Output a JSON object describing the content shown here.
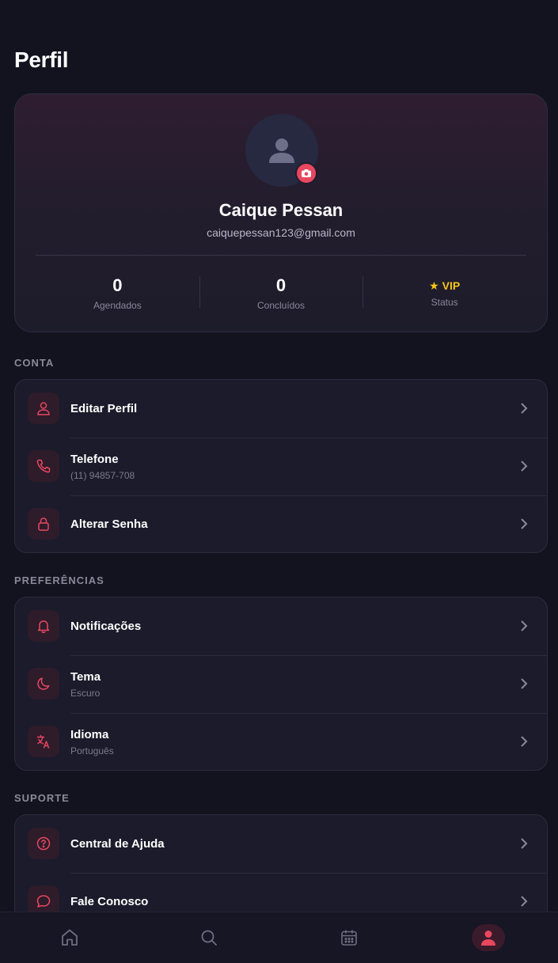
{
  "header": {
    "title": "Perfil"
  },
  "profile": {
    "name": "Caique Pessan",
    "email": "caiquepessan123@gmail.com",
    "stats": [
      {
        "value": "0",
        "label": "Agendados"
      },
      {
        "value": "0",
        "label": "Concluídos"
      },
      {
        "value": "★ VIP",
        "label": "Status"
      }
    ]
  },
  "sections": {
    "conta": {
      "title": "CONTA",
      "items": [
        {
          "label": "Editar Perfil",
          "sub": "",
          "icon": "user-icon"
        },
        {
          "label": "Telefone",
          "sub": "(11) 94857-708",
          "icon": "phone-icon"
        },
        {
          "label": "Alterar Senha",
          "sub": "",
          "icon": "lock-icon"
        }
      ]
    },
    "preferencias": {
      "title": "PREFERÊNCIAS",
      "items": [
        {
          "label": "Notificações",
          "sub": "",
          "icon": "bell-icon"
        },
        {
          "label": "Tema",
          "sub": "Escuro",
          "icon": "moon-icon"
        },
        {
          "label": "Idioma",
          "sub": "Português",
          "icon": "translate-icon"
        }
      ]
    },
    "suporte": {
      "title": "SUPORTE",
      "items": [
        {
          "label": "Central de Ajuda",
          "sub": "",
          "icon": "help-circle-icon"
        },
        {
          "label": "Fale Conosco",
          "sub": "",
          "icon": "chat-icon"
        }
      ]
    }
  },
  "bottom_nav": {
    "items": [
      {
        "icon": "home-icon",
        "active": false
      },
      {
        "icon": "search-icon",
        "active": false
      },
      {
        "icon": "calendar-icon",
        "active": false
      },
      {
        "icon": "profile-icon",
        "active": true
      }
    ]
  },
  "colors": {
    "background": "#13131f",
    "accent": "#e8475f",
    "vip": "#f5c518",
    "card": "#1b1b2b"
  }
}
